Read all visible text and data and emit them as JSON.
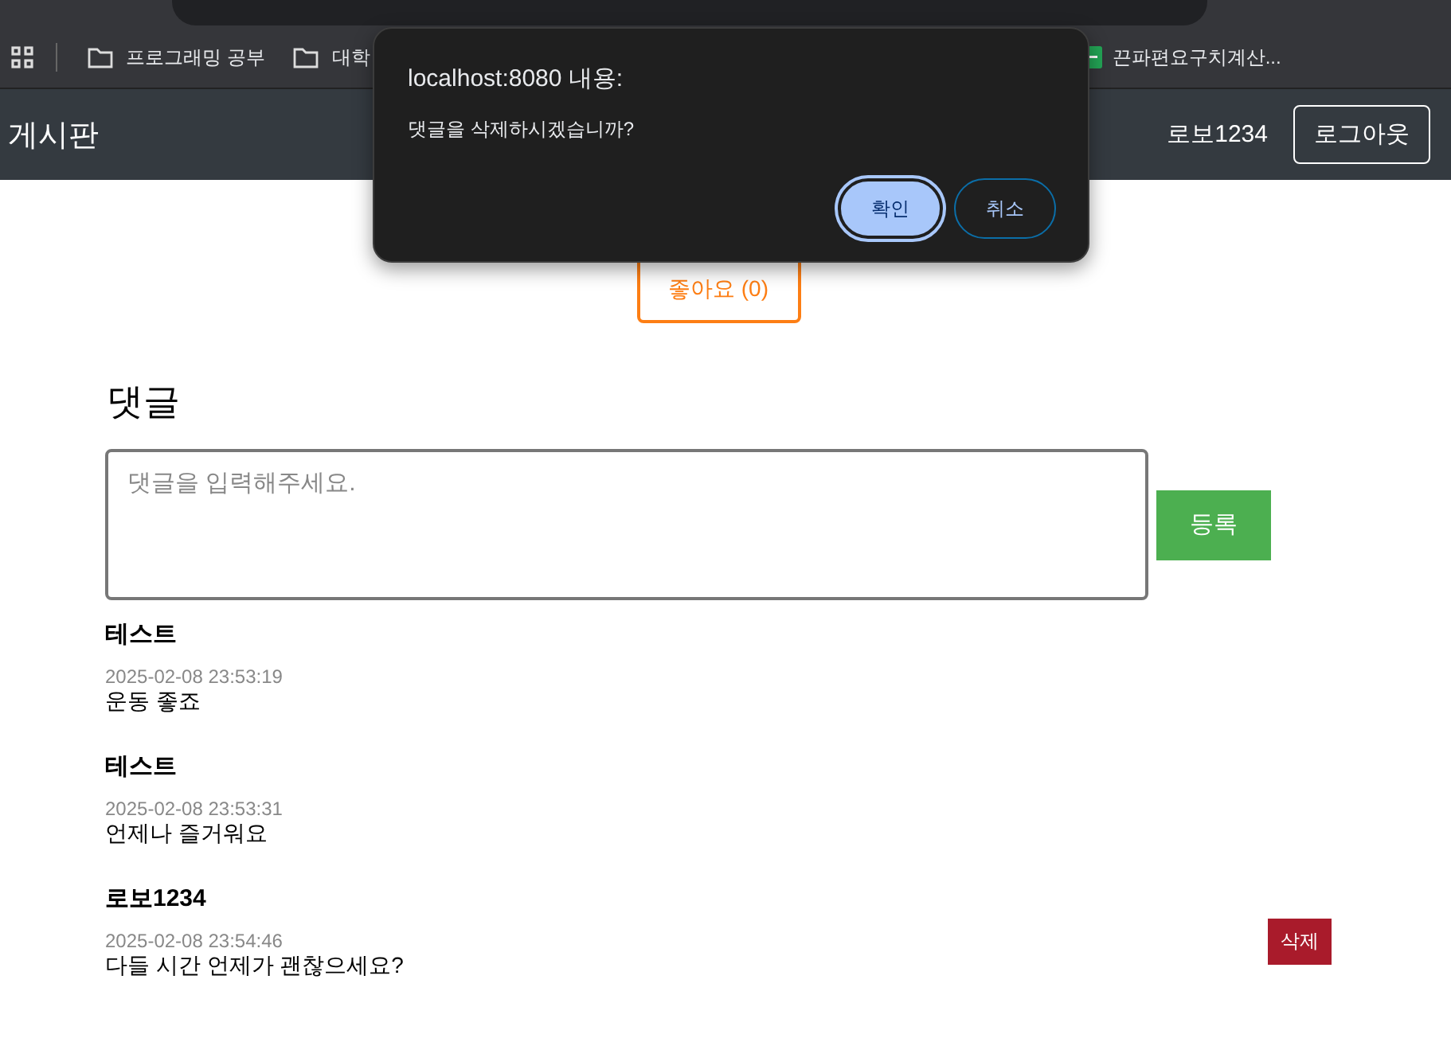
{
  "browser": {
    "bookmarks": [
      {
        "label": "프로그래밍 공부",
        "kind": "folder"
      },
      {
        "label": "대학",
        "kind": "folder"
      },
      {
        "label": "끈파편요구치계산...",
        "kind": "sheet"
      }
    ]
  },
  "navbar": {
    "brand": "게시판",
    "user": "로보1234",
    "logout": "로그아웃"
  },
  "like_button": "좋아요 (0)",
  "comments_section": {
    "heading": "댓글",
    "placeholder": "댓글을 입력해주세요.",
    "submit": "등록",
    "comments": [
      {
        "author": "테스트",
        "date": "2025-02-08 23:53:19",
        "text": "운동 좋죠"
      },
      {
        "author": "테스트",
        "date": "2025-02-08 23:53:31",
        "text": "언제나 즐거워요"
      },
      {
        "author": "로보1234",
        "date": "2025-02-08 23:54:46",
        "text": "다들 시간 언제가 괜찮으세요?",
        "delete_label": "삭제"
      }
    ]
  },
  "dialog": {
    "title": "localhost:8080 내용:",
    "message": "댓글을 삭제하시겠습니까?",
    "buttons": [
      {
        "label": "확인",
        "selected": true
      },
      {
        "label": "취소",
        "selected": false
      }
    ]
  }
}
